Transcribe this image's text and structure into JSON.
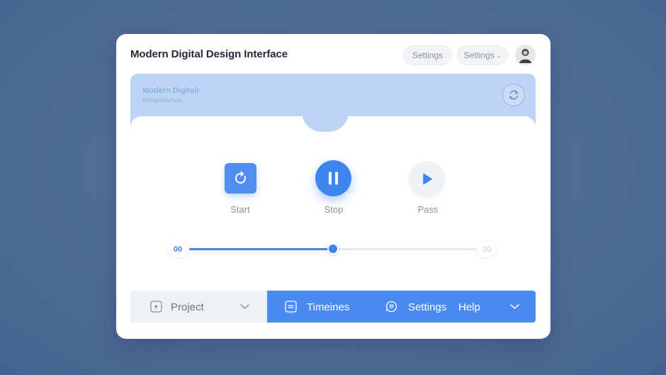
{
  "header": {
    "title": "Modern Digital Design Interface",
    "pill1_label": "Settings",
    "pill2_label": "Settings",
    "pill2_chevron": "⌄"
  },
  "panel": {
    "title": "Modern Digitalr",
    "subtitle": "Designinterface"
  },
  "controls": {
    "start_label": "Start",
    "stop_label": "Stop",
    "pass_label": "Pass"
  },
  "progress": {
    "start_time": "00",
    "end_time": "00",
    "fraction": 0.5
  },
  "bottom_bar": {
    "project_label": "Project",
    "timelines_label": "Timeines",
    "settings_label": "Settings",
    "help_label": "Help"
  },
  "colors": {
    "accent": "#3f85f0",
    "panel": "#bcd5f6",
    "background": "#4f6c96"
  },
  "icons": [
    "refresh-icon",
    "replay-icon",
    "pause-icon",
    "play-icon",
    "video-icon",
    "chevron-down-icon",
    "timeline-icon",
    "settings-icon",
    "avatar-icon"
  ]
}
